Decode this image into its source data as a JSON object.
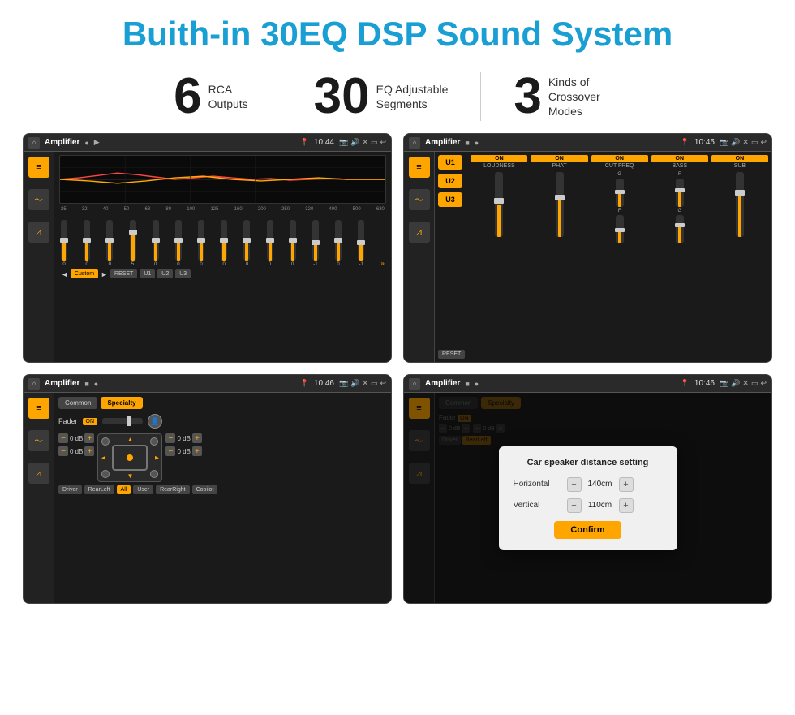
{
  "header": {
    "title": "Buith-in 30EQ DSP Sound System"
  },
  "stats": [
    {
      "number": "6",
      "label_line1": "RCA",
      "label_line2": "Outputs"
    },
    {
      "number": "30",
      "label_line1": "EQ Adjustable",
      "label_line2": "Segments"
    },
    {
      "number": "3",
      "label_line1": "Kinds of",
      "label_line2": "Crossover Modes"
    }
  ],
  "screens": {
    "screen1": {
      "title": "Amplifier",
      "time": "10:44",
      "eq_freqs": [
        "25",
        "32",
        "40",
        "50",
        "63",
        "80",
        "100",
        "125",
        "160",
        "200",
        "250",
        "320",
        "400",
        "500",
        "630"
      ],
      "eq_values": [
        "0",
        "0",
        "0",
        "5",
        "0",
        "0",
        "0",
        "0",
        "0",
        "0",
        "0",
        "-1",
        "0",
        "-1"
      ],
      "eq_presets": [
        "Custom",
        "RESET",
        "U1",
        "U2",
        "U3"
      ]
    },
    "screen2": {
      "title": "Amplifier",
      "time": "10:45",
      "channels": [
        "LOUDNESS",
        "PHAT",
        "CUT FREQ",
        "BASS",
        "SUB"
      ],
      "u_buttons": [
        "U1",
        "U2",
        "U3"
      ],
      "reset_label": "RESET"
    },
    "screen3": {
      "title": "Amplifier",
      "time": "10:46",
      "tabs": [
        "Common",
        "Specialty"
      ],
      "active_tab": "Specialty",
      "fader_label": "Fader",
      "fader_on": "ON",
      "db_values": [
        "0 dB",
        "0 dB",
        "0 dB",
        "0 dB"
      ],
      "bottom_buttons": [
        "Driver",
        "RearLeft",
        "All",
        "User",
        "RearRight",
        "Copilot"
      ]
    },
    "screen4": {
      "title": "Amplifier",
      "time": "10:46",
      "tabs": [
        "Common",
        "Specialty"
      ],
      "dialog": {
        "title": "Car speaker distance setting",
        "horizontal_label": "Horizontal",
        "horizontal_value": "140cm",
        "vertical_label": "Vertical",
        "vertical_value": "110cm",
        "confirm_label": "Confirm"
      }
    }
  }
}
